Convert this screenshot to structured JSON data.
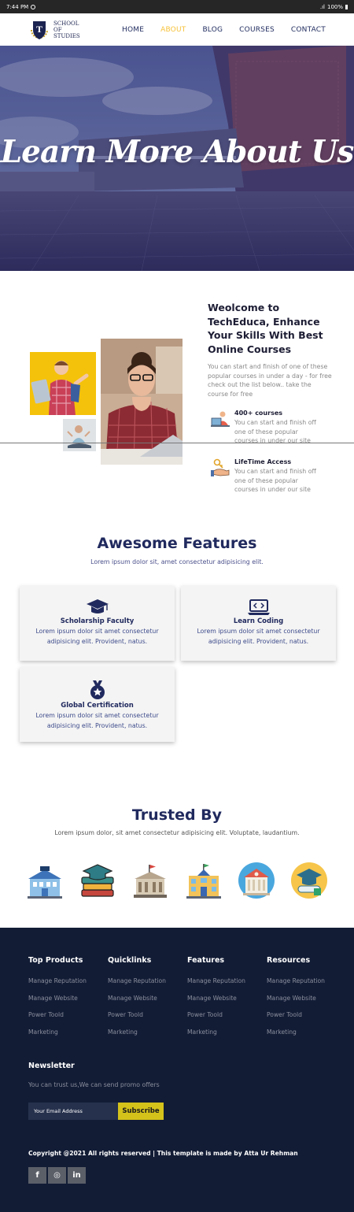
{
  "status": {
    "time": "7:44 PM",
    "battery": "100%"
  },
  "logo": {
    "letter": "T",
    "line1": "SCHOOL",
    "line2": "OF",
    "line3": "STUDIES"
  },
  "nav": {
    "items": [
      "HOME",
      "ABOUT",
      "BLOG",
      "COURSES",
      "CONTACT"
    ],
    "active": "ABOUT"
  },
  "hero": {
    "title": "Learn More About Us"
  },
  "welcome": {
    "title": "Weolcome to TechEduca, Enhance Your Skills With Best Online Courses",
    "text": "You can start and finish of one of these popular courses in under a day - for free check out the list below.. take the course for free",
    "features": [
      {
        "title": "400+ courses",
        "text": "You can start and finish off one of these popular courses in under our site",
        "icon": "teacher-icon"
      },
      {
        "title": "LifeTime Access",
        "text": "You can start and finish off one of these popular courses in under our site",
        "icon": "key-hand-icon"
      }
    ]
  },
  "features": {
    "title": "Awesome Features",
    "subtitle": "Lorem ipsum dolor sit, amet consectetur adipisicing elit.",
    "cards": [
      {
        "title": "Scholarship Faculty",
        "text": "Lorem ipsum dolor sit amet consectetur adipisicing elit. Provident, natus.",
        "icon": "graduation-cap-icon"
      },
      {
        "title": "Learn Coding",
        "text": "Lorem ipsum dolor sit amet consectetur adipisicing elit. Provident, natus.",
        "icon": "laptop-code-icon"
      },
      {
        "title": "Global Certification",
        "text": "Lorem ipsum dolor sit amet consectetur adipisicing elit. Provident, natus.",
        "icon": "medal-icon"
      }
    ]
  },
  "trusted": {
    "title": "Trusted By",
    "subtitle": "Lorem ipsum dolor, sit amet consectetur adipisicing elit. Voluptate, laudantium.",
    "logos": [
      "university-icon",
      "books-cap-icon",
      "museum-icon",
      "school-icon",
      "institution-icon",
      "diploma-icon"
    ]
  },
  "footer": {
    "columns": [
      {
        "title": "Top Products",
        "links": [
          "Manage Reputation",
          "Manage Website",
          "Power Toold",
          "Marketing"
        ]
      },
      {
        "title": "Quicklinks",
        "links": [
          "Manage Reputation",
          "Manage Website",
          "Power Toold",
          "Marketing"
        ]
      },
      {
        "title": "Features",
        "links": [
          "Manage Reputation",
          "Manage Website",
          "Power Toold",
          "Marketing"
        ]
      },
      {
        "title": "Resources",
        "links": [
          "Manage Reputation",
          "Manage Website",
          "Power Toold",
          "Marketing"
        ]
      }
    ],
    "newsletter": {
      "title": "Newsletter",
      "text": "You can trust us,We can send promo offers",
      "placeholder": "Your Email Address",
      "button": "Subscribe"
    },
    "copyright": "Copyright @2021 All rights reserved | This template is made by Atta Ur Rehman",
    "socials": [
      {
        "icon": "facebook-icon",
        "glyph": "f"
      },
      {
        "icon": "instagram-icon",
        "glyph": "◎"
      },
      {
        "icon": "linkedin-icon",
        "glyph": "in"
      }
    ]
  },
  "colors": {
    "navy": "#212a5e",
    "accent": "#f7c23a",
    "footer": "#121c35",
    "button": "#d4c21b"
  }
}
